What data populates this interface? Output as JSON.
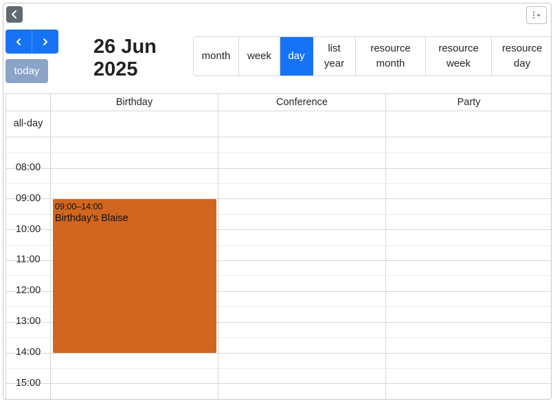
{
  "toolbar": {
    "back_icon": "chevron-left-icon",
    "menu_icon": "kebab-menu-icon",
    "prev_icon": "chevron-left-icon",
    "next_icon": "chevron-right-icon",
    "today_label": "today",
    "title_line1": "26 Jun",
    "title_line2": "2025",
    "views": [
      {
        "label": "month",
        "active": false
      },
      {
        "label": "week",
        "active": false
      },
      {
        "label": "day",
        "active": true
      },
      {
        "label": "list\nyear",
        "active": false
      },
      {
        "label": "resource\nmonth",
        "active": false
      },
      {
        "label": "resource\nweek",
        "active": false
      },
      {
        "label": "resource\nday",
        "active": false
      }
    ]
  },
  "calendar": {
    "resources": [
      "Birthday",
      "Conference",
      "Party"
    ],
    "all_day_label": "all-day",
    "times": [
      "08:00",
      "09:00",
      "10:00",
      "11:00",
      "12:00",
      "13:00",
      "14:00",
      "15:00"
    ],
    "events": [
      {
        "resource": "Birthday",
        "time": "09:00–14:00",
        "title": "Birthday's Blaise",
        "color": "#d2661e"
      }
    ]
  },
  "colors": {
    "primary": "#1673f5",
    "today_disabled": "#8aa3c7",
    "event": "#d2661e",
    "border": "#d6d6d6"
  }
}
